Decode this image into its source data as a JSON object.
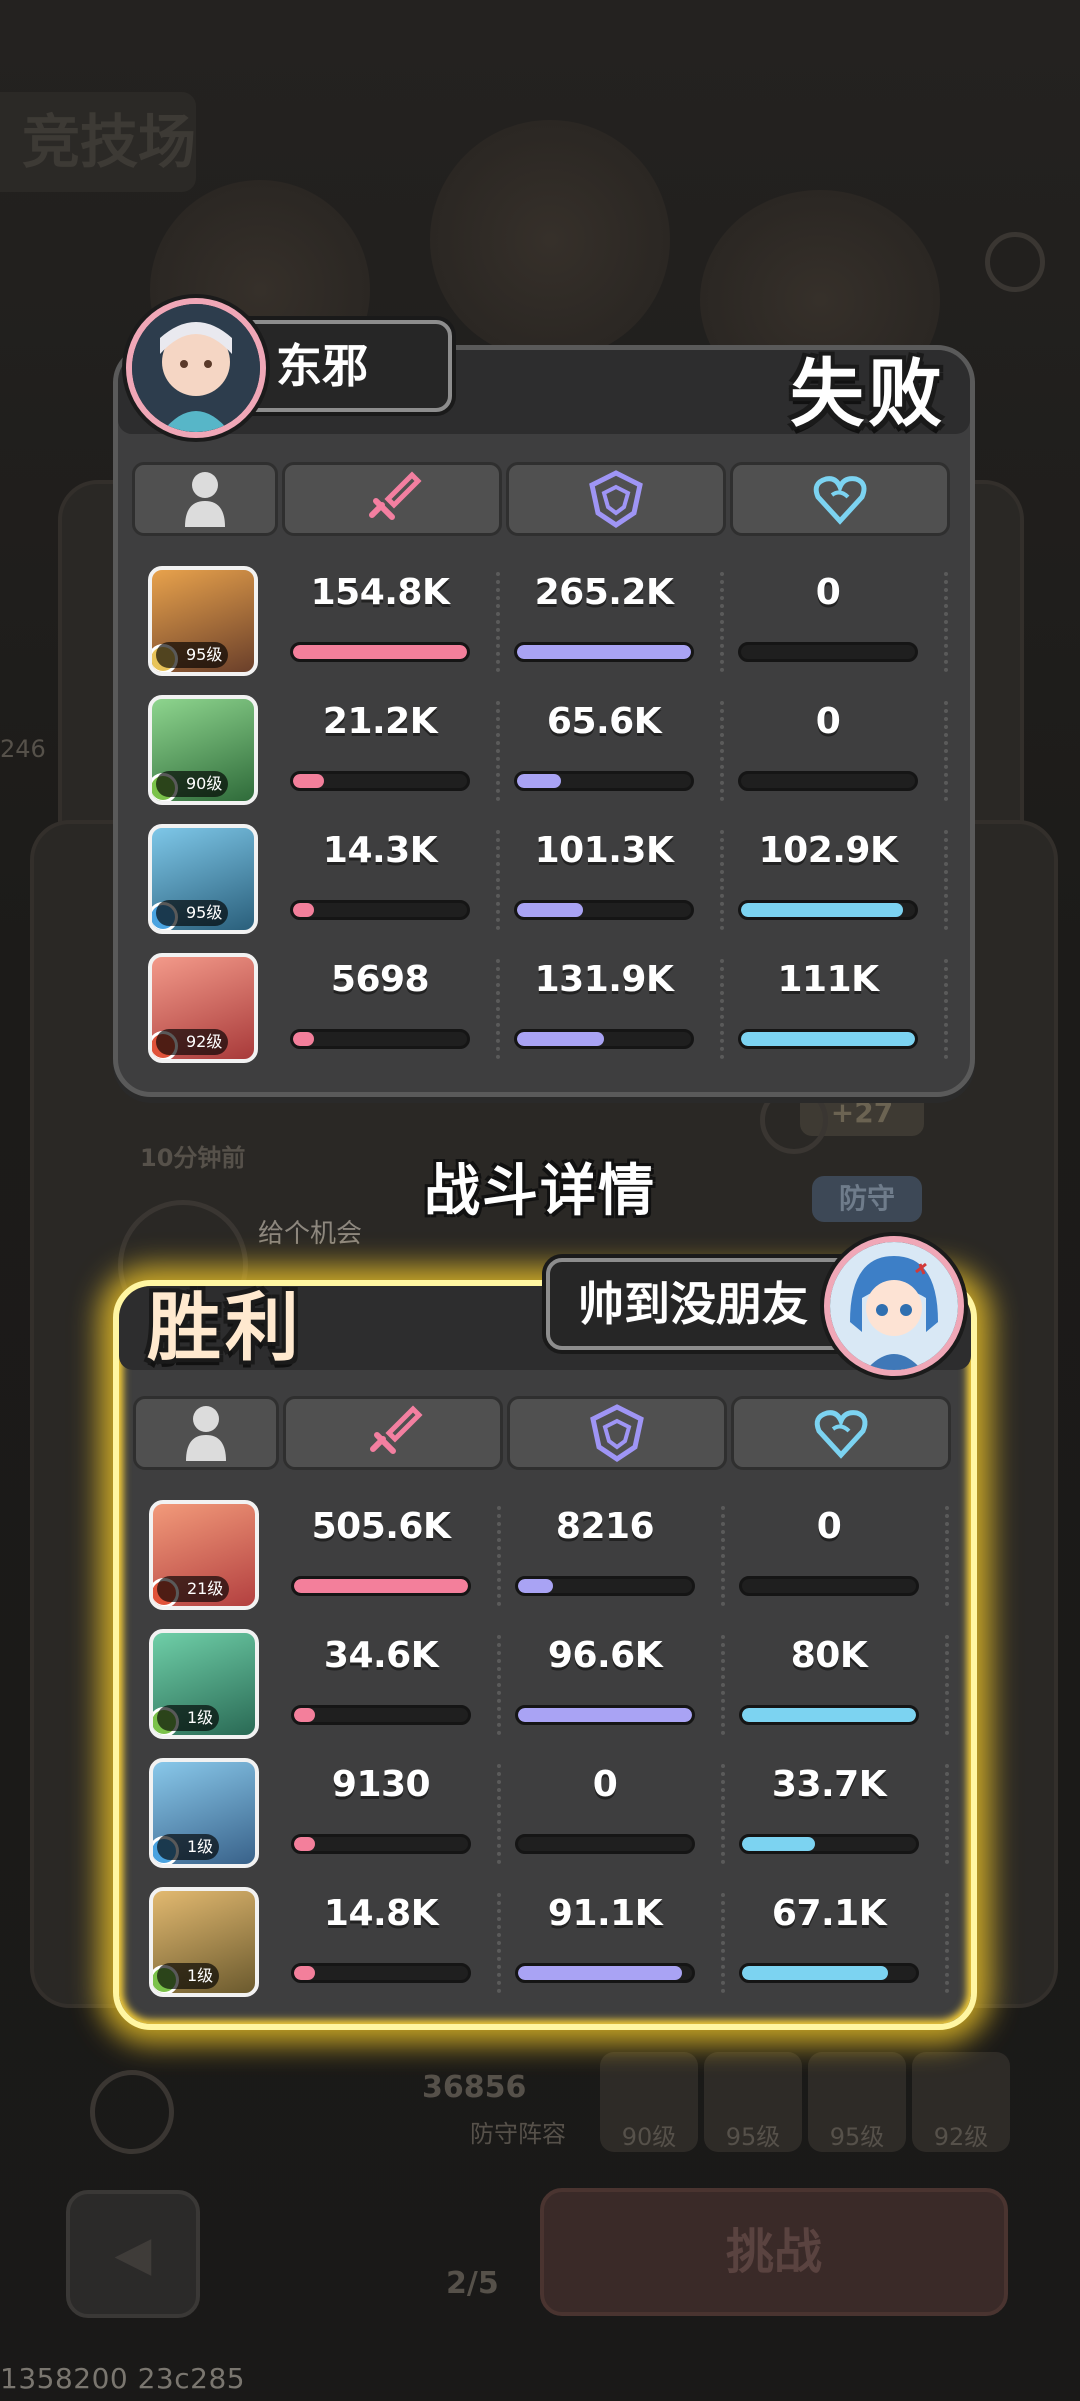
{
  "background": {
    "arena_title": "竞技场",
    "left_num": "246",
    "time_ago": "10分钟前",
    "opponent_msg": "给个机会",
    "defend_tag": "防守",
    "points_badge": "+27",
    "power": "36856",
    "defense_lineup": "防守阵容",
    "team_levels": [
      "90级",
      "95级",
      "95级",
      "92级"
    ],
    "challenge_btn": "挑战",
    "attempts": "2/5"
  },
  "battle_title": "战斗详情",
  "footer_id": "1358200 23c285",
  "colors": {
    "damage": "#f37f9b",
    "tank": "#a9a3f4",
    "heal": "#7cd3f1",
    "win_glow": "#ffd63a"
  },
  "header_icons": [
    "hero-icon",
    "sword-icon",
    "shield-icon",
    "heart-icon"
  ],
  "loser_panel": {
    "player_name": "东邪",
    "result": "失败",
    "rows": [
      {
        "level": "95级",
        "element": "earth",
        "damage": "154.8K",
        "tank": "265.2K",
        "heal": "0",
        "damage_pct": 1.0,
        "tank_pct": 1.0,
        "heal_pct": 0.0,
        "palette": [
          "#e8a24c",
          "#6a3f2a"
        ]
      },
      {
        "level": "90级",
        "element": "wind",
        "damage": "21.2K",
        "tank": "65.6K",
        "heal": "0",
        "damage_pct": 0.18,
        "tank_pct": 0.25,
        "heal_pct": 0.0,
        "palette": [
          "#8ed58e",
          "#2f6b3a"
        ]
      },
      {
        "level": "95级",
        "element": "water",
        "damage": "14.3K",
        "tank": "101.3K",
        "heal": "102.9K",
        "damage_pct": 0.12,
        "tank_pct": 0.38,
        "heal_pct": 0.93,
        "palette": [
          "#7ec7e8",
          "#2a5f7b"
        ]
      },
      {
        "level": "92级",
        "element": "fire",
        "damage": "5698",
        "tank": "131.9K",
        "heal": "111K",
        "damage_pct": 0.12,
        "tank_pct": 0.5,
        "heal_pct": 1.0,
        "palette": [
          "#f39a8a",
          "#a83a3a"
        ]
      }
    ]
  },
  "winner_panel": {
    "player_name": "帅到没朋友",
    "result": "胜利",
    "rows": [
      {
        "level": "21级",
        "element": "fire",
        "damage": "505.6K",
        "tank": "8216",
        "heal": "0",
        "damage_pct": 1.0,
        "tank_pct": 0.2,
        "heal_pct": 0.0,
        "palette": [
          "#f29a7a",
          "#b34040"
        ]
      },
      {
        "level": "1级",
        "element": "wind",
        "damage": "34.6K",
        "tank": "96.6K",
        "heal": "80K",
        "damage_pct": 0.12,
        "tank_pct": 1.0,
        "heal_pct": 1.0,
        "palette": [
          "#6fcfa8",
          "#2a6a55"
        ]
      },
      {
        "level": "1级",
        "element": "water",
        "damage": "9130",
        "tank": "0",
        "heal": "33.7K",
        "damage_pct": 0.12,
        "tank_pct": 0.0,
        "heal_pct": 0.42,
        "palette": [
          "#89c8ea",
          "#39628a"
        ]
      },
      {
        "level": "1级",
        "element": "wind",
        "damage": "14.8K",
        "tank": "91.1K",
        "heal": "67.1K",
        "damage_pct": 0.12,
        "tank_pct": 0.94,
        "heal_pct": 0.84,
        "palette": [
          "#e2b970",
          "#6b5a2e"
        ]
      }
    ]
  }
}
